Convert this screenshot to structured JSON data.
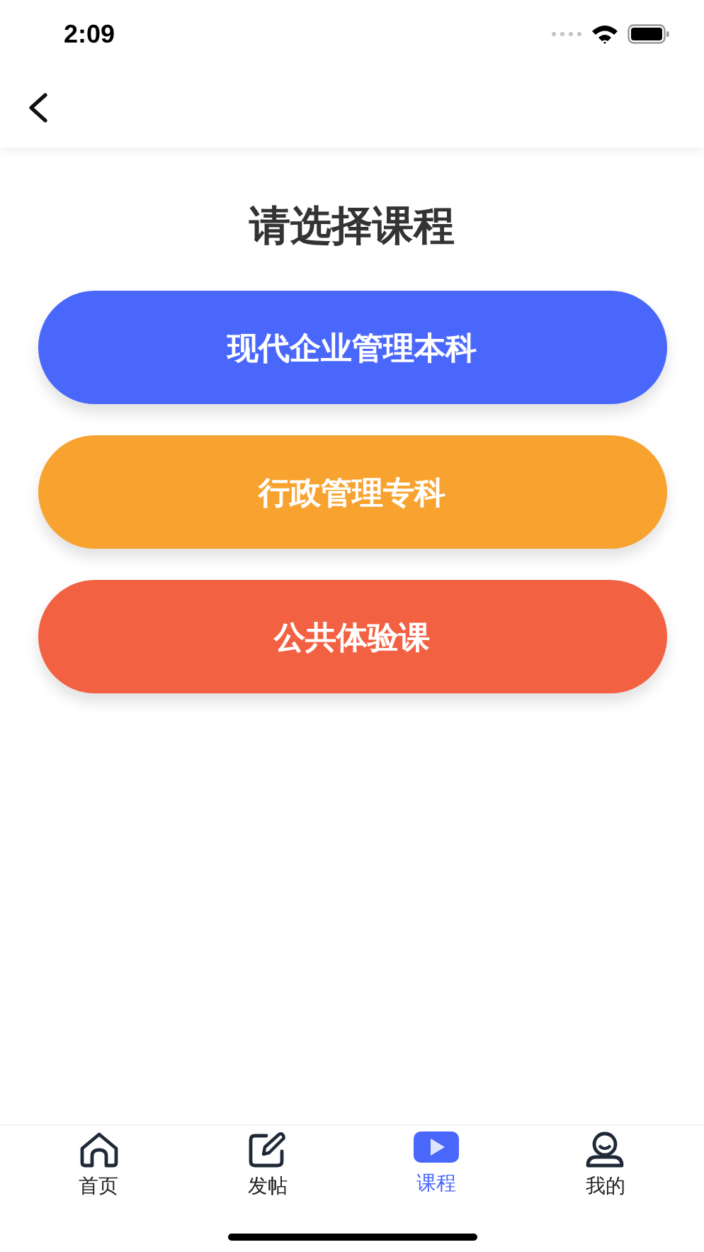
{
  "status_bar": {
    "time": "2:09"
  },
  "heading": "请选择课程",
  "courses": [
    {
      "label": "现代企业管理本科",
      "color": "#4a67fb"
    },
    {
      "label": "行政管理专科",
      "color": "#f8a22f"
    },
    {
      "label": "公共体验课",
      "color": "#f26142"
    }
  ],
  "tab_bar": [
    {
      "label": "首页",
      "kind": "home",
      "selected": false
    },
    {
      "label": "发帖",
      "kind": "post",
      "selected": false
    },
    {
      "label": "课程",
      "kind": "course",
      "selected": true
    },
    {
      "label": "我的",
      "kind": "profile",
      "selected": false
    }
  ]
}
